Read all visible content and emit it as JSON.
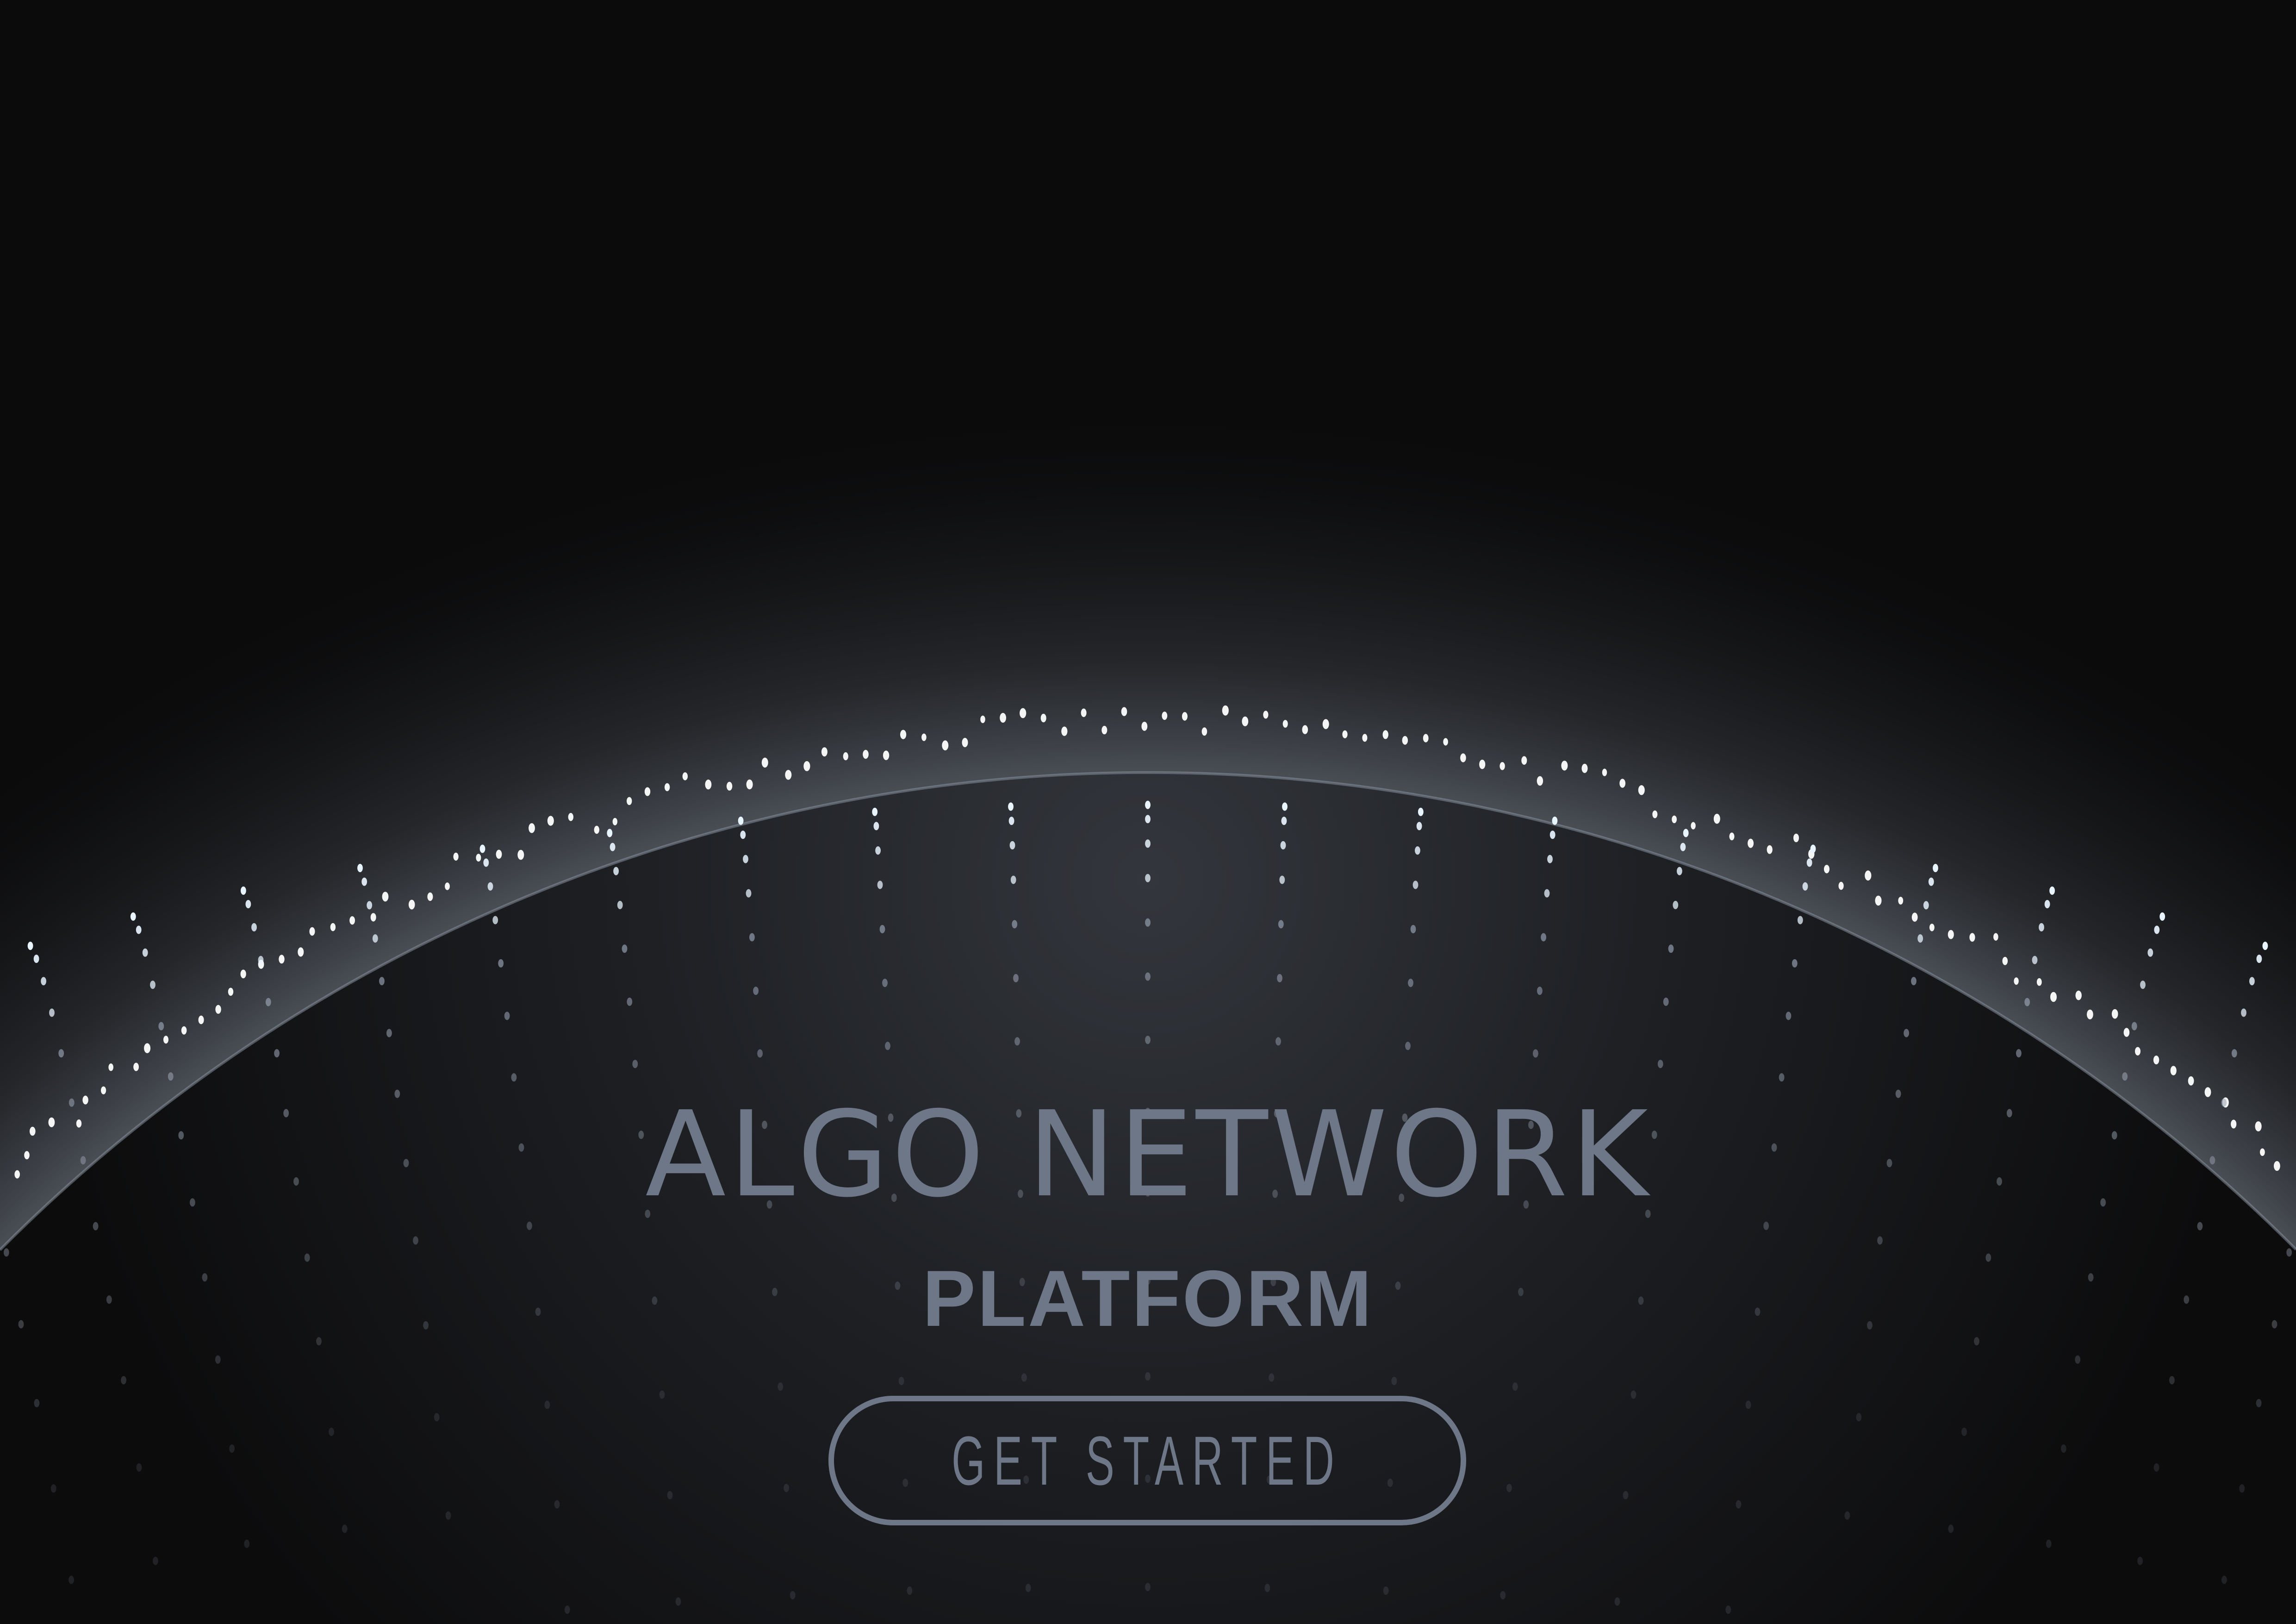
{
  "hero": {
    "title": "ALGO NETWORK",
    "subtitle": "PLATFORM",
    "cta_label": "GET STARTED"
  },
  "colors": {
    "background": "#0b0b0c",
    "text": "#6e7787",
    "planet": "#2c2f34",
    "halo": "#8a93a3",
    "dots": "#ffffff"
  },
  "icons": [
    "planet-globe-graphic",
    "particle-dots"
  ]
}
